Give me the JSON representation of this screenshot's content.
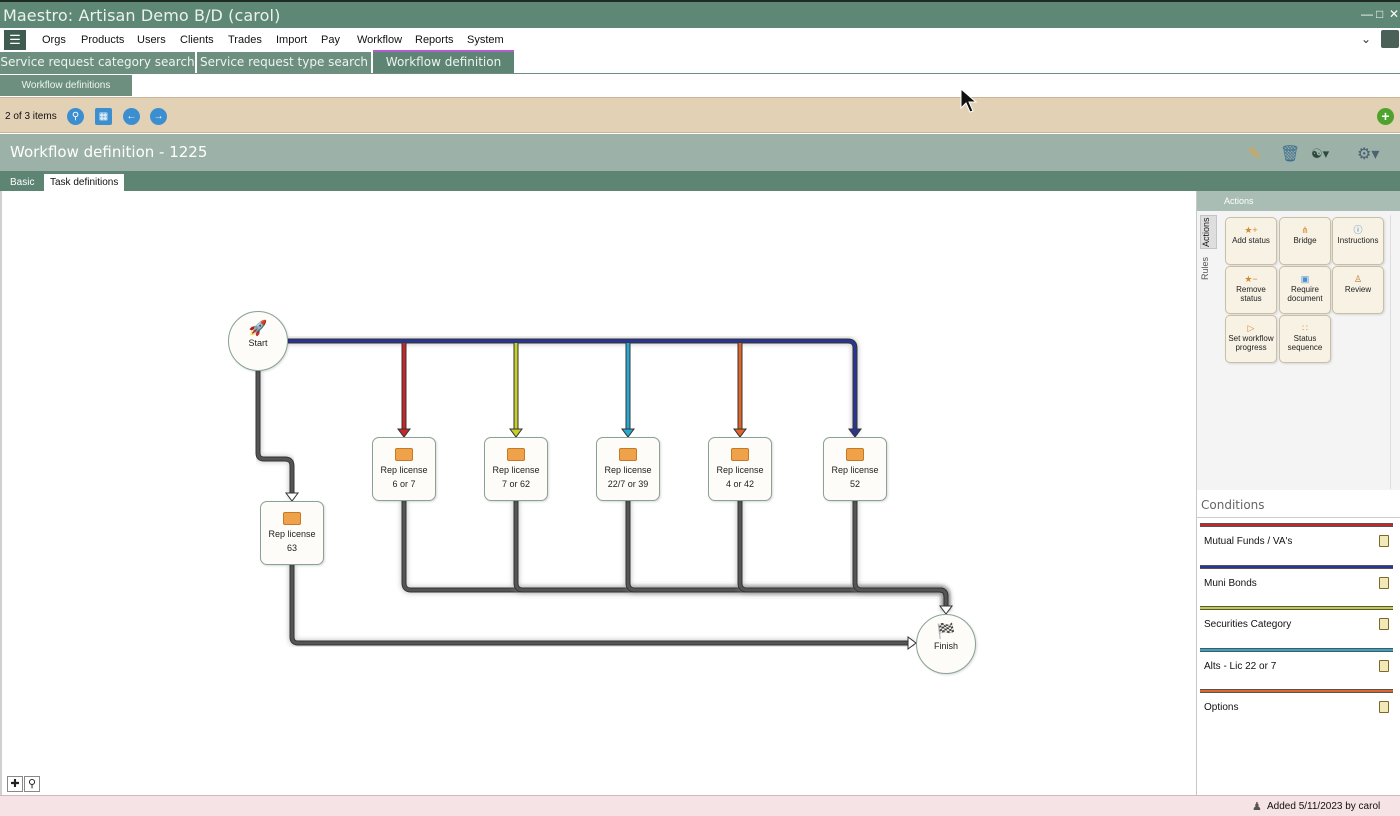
{
  "window": {
    "title": "Maestro: Artisan Demo B/D (carol)"
  },
  "menu": {
    "items": [
      "Orgs",
      "Products",
      "Users",
      "Clients",
      "Trades",
      "Import",
      "Pay",
      "Workflow",
      "Reports",
      "System"
    ]
  },
  "tabs": {
    "primary": [
      "Service request category search",
      "Service request type search",
      "Workflow definition"
    ],
    "active_primary": "Workflow definition",
    "secondary": "Workflow definitions"
  },
  "toolbar": {
    "items_count": "2 of 3 items"
  },
  "record": {
    "title": "Workflow definition - 1225"
  },
  "inner_tabs": [
    "Basic",
    "Task definitions"
  ],
  "workflow": {
    "start_label": "Start",
    "finish_label": "Finish",
    "tasks": [
      {
        "line1": "Rep license",
        "line2": "63"
      },
      {
        "line1": "Rep license",
        "line2": "6 or 7"
      },
      {
        "line1": "Rep license",
        "line2": "7 or 62"
      },
      {
        "line1": "Rep license",
        "line2": "22/7 or 39"
      },
      {
        "line1": "Rep license",
        "line2": "4 or 42"
      },
      {
        "line1": "Rep license",
        "line2": "52"
      }
    ],
    "connector_colors": {
      "default": "#555555",
      "mutual_funds": "#c62828",
      "muni_bonds": "#283593",
      "securities": "#c6cf2b",
      "alts": "#29a9d1",
      "options": "#e0652a"
    }
  },
  "actions_panel": {
    "header": "Actions",
    "side_tabs": [
      "Actions",
      "Rules"
    ],
    "buttons": [
      {
        "label": "Add status",
        "icon": "add-status-icon"
      },
      {
        "label": "Bridge",
        "icon": "bridge-icon"
      },
      {
        "label": "Instructions",
        "icon": "info-icon"
      },
      {
        "label": "Remove status",
        "icon": "remove-status-icon"
      },
      {
        "label": "Require document",
        "icon": "document-icon"
      },
      {
        "label": "Review",
        "icon": "person-icon"
      },
      {
        "label": "Set workflow progress",
        "icon": "progress-icon"
      },
      {
        "label": "Status sequence",
        "icon": "sequence-icon"
      }
    ]
  },
  "conditions": {
    "title": "Conditions",
    "items": [
      {
        "label": "Mutual Funds / VA's",
        "color": "#c62828"
      },
      {
        "label": "Muni Bonds",
        "color": "#283593"
      },
      {
        "label": "Securities Category",
        "color": "#c6cf2b"
      },
      {
        "label": "Alts - Lic 22 or 7",
        "color": "#29a9d1"
      },
      {
        "label": "Options",
        "color": "#e0652a"
      }
    ]
  },
  "status": {
    "text": "Added 5/11/2023 by carol"
  }
}
